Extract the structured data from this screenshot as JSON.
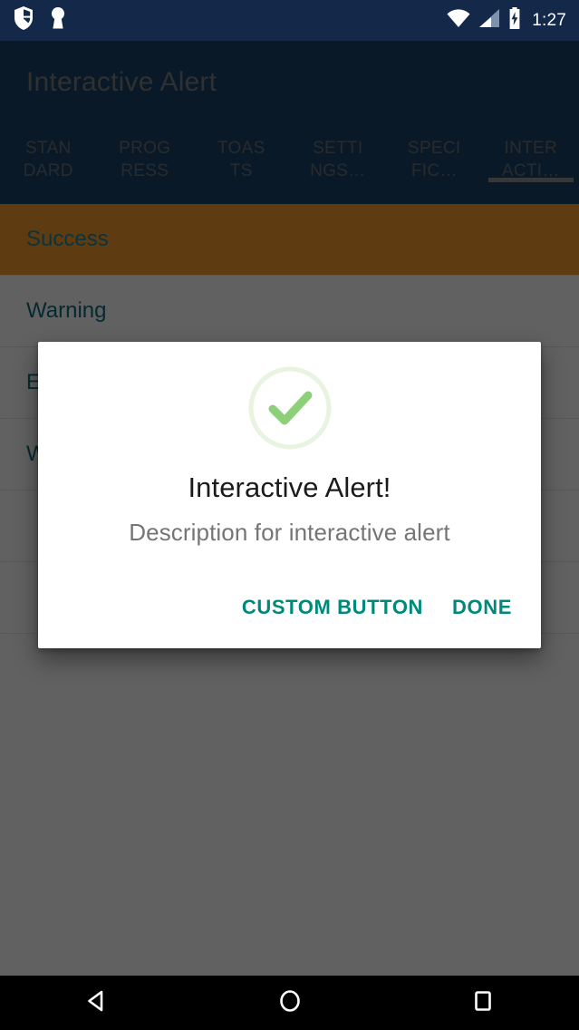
{
  "status_bar": {
    "icons_left": [
      "shield-icon",
      "vpn-key-icon"
    ],
    "icons_right": [
      "wifi-icon",
      "cell-signal-icon",
      "battery-charging-icon"
    ],
    "time": "1:27",
    "background_color": "#14294a"
  },
  "toolbar": {
    "title": "Interactive Alert",
    "background_color": "#1b4368",
    "tabs": [
      {
        "line1": "STAN",
        "line2": "DARD",
        "selected": false
      },
      {
        "line1": "PROG",
        "line2": "RESS",
        "selected": false
      },
      {
        "line1": "TOAS",
        "line2": "TS",
        "selected": false
      },
      {
        "line1": "SETTI",
        "line2": "NGS…",
        "selected": false
      },
      {
        "line1": "SPECI",
        "line2": "FIC…",
        "selected": false
      },
      {
        "line1": "INTER",
        "line2": "ACTI…",
        "selected": true
      }
    ]
  },
  "list": {
    "items": [
      {
        "label": "Success",
        "pressed": true
      },
      {
        "label": "Warning",
        "pressed": false
      },
      {
        "label": "Error",
        "pressed": false
      },
      {
        "label": "With custom view",
        "pressed": false
      },
      {
        "label": "",
        "pressed": false
      },
      {
        "label": "",
        "pressed": false
      }
    ],
    "pressed_highlight_color": "#f89b2e",
    "text_color": "#0d6e82"
  },
  "dialog": {
    "icon": "check-circle-icon",
    "icon_stroke_color": "#8ed07a",
    "icon_ring_color": "#e8f3e0",
    "title": "Interactive Alert!",
    "description": "Description for interactive alert",
    "buttons": [
      {
        "label": "CUSTOM BUTTON",
        "name": "custom-button"
      },
      {
        "label": "DONE",
        "name": "done-button"
      }
    ],
    "button_color": "#00897b"
  },
  "nav_bar": {
    "buttons": [
      {
        "name": "back-button",
        "icon": "triangle-back-icon"
      },
      {
        "name": "home-button",
        "icon": "circle-home-icon"
      },
      {
        "name": "recents-button",
        "icon": "square-recents-icon"
      }
    ],
    "background_color": "#000000"
  }
}
